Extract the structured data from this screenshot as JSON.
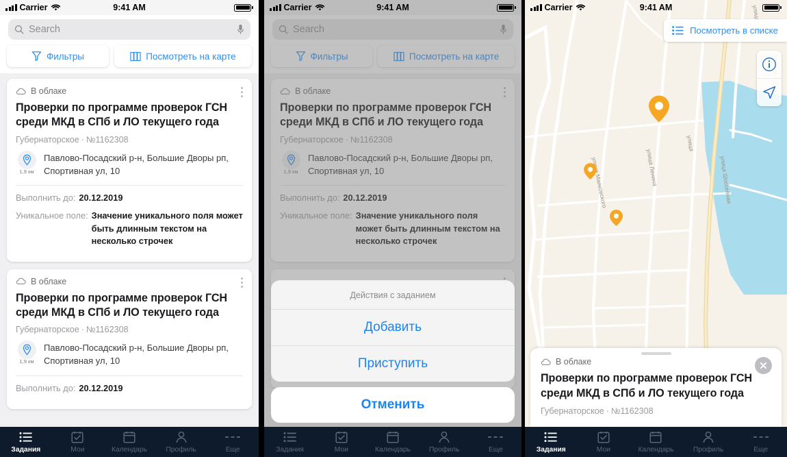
{
  "status_bar": {
    "carrier": "Carrier",
    "time": "9:41 AM"
  },
  "search": {
    "placeholder": "Search",
    "icon": "search-icon",
    "mic_icon": "microphone-icon"
  },
  "filter_row": {
    "filters_label": "Фильтры",
    "filters_icon": "funnel-icon",
    "map_label": "Посмотреть на карте",
    "map_icon": "map-columns-icon"
  },
  "card": {
    "status_label": "В облаке",
    "status_icon": "cloud-icon",
    "menu_icon": "kebab-menu-icon",
    "title": "Проверки по программе проверок ГСН среди МКД в СПб и ЛО текущего года",
    "meta_type": "Губернаторское",
    "meta_sep": "·",
    "meta_number": "№1162308",
    "distance": "1,9 км",
    "pin_icon": "location-pin-icon",
    "address": "Павлово-Посадский р-н, Большие Дворы рп, Спортивная ул, 10",
    "due_key": "Выполнить до:",
    "due_value": "20.12.2019",
    "unique_key": "Уникальное поле:",
    "unique_value": "Значение уникального поля может быть длинным текстом на несколько строчек"
  },
  "map_card": {
    "status_label": "В облаке",
    "title": "Проверки по программе проверок ГСН среди МКД в СПб и ЛО текущего года",
    "meta_type": "Губернаторское",
    "meta_sep": "·",
    "meta_number": "№1162308",
    "close_icon": "close-icon",
    "grabber": "drag-handle"
  },
  "map": {
    "list_button_label": "Посмотреть в списке",
    "list_button_icon": "list-icon",
    "info_icon": "info-icon",
    "locate_icon": "navigate-arrow-icon",
    "streets": [
      "улица Маяковского",
      "улица Ленина",
      "улица Шоссейная",
      "улица С"
    ],
    "pin_count": 3,
    "colors": {
      "land": "#f6f2e9",
      "water": "#a9dcec",
      "road": "#ffffff",
      "highway": "#f7e3a8",
      "pin": "#f5a623"
    }
  },
  "action_sheet": {
    "title": "Действия с заданием",
    "items": [
      "Добавить",
      "Приступить"
    ],
    "cancel": "Отменить"
  },
  "tabbar": {
    "items": [
      {
        "label": "Задания",
        "icon": "list-bullet-icon",
        "active": true
      },
      {
        "label": "Мои",
        "icon": "calendar-check-icon",
        "active": false
      },
      {
        "label": "Календарь",
        "icon": "calendar-icon",
        "active": false
      },
      {
        "label": "Профиль",
        "icon": "person-icon",
        "active": false
      },
      {
        "label": "Еще",
        "icon": "ellipsis-icon",
        "active": false
      }
    ]
  },
  "theme": {
    "accent": "#2f8fef",
    "tabbar_bg": "#0d1b2d",
    "sheet_blue": "#1b84f5"
  }
}
